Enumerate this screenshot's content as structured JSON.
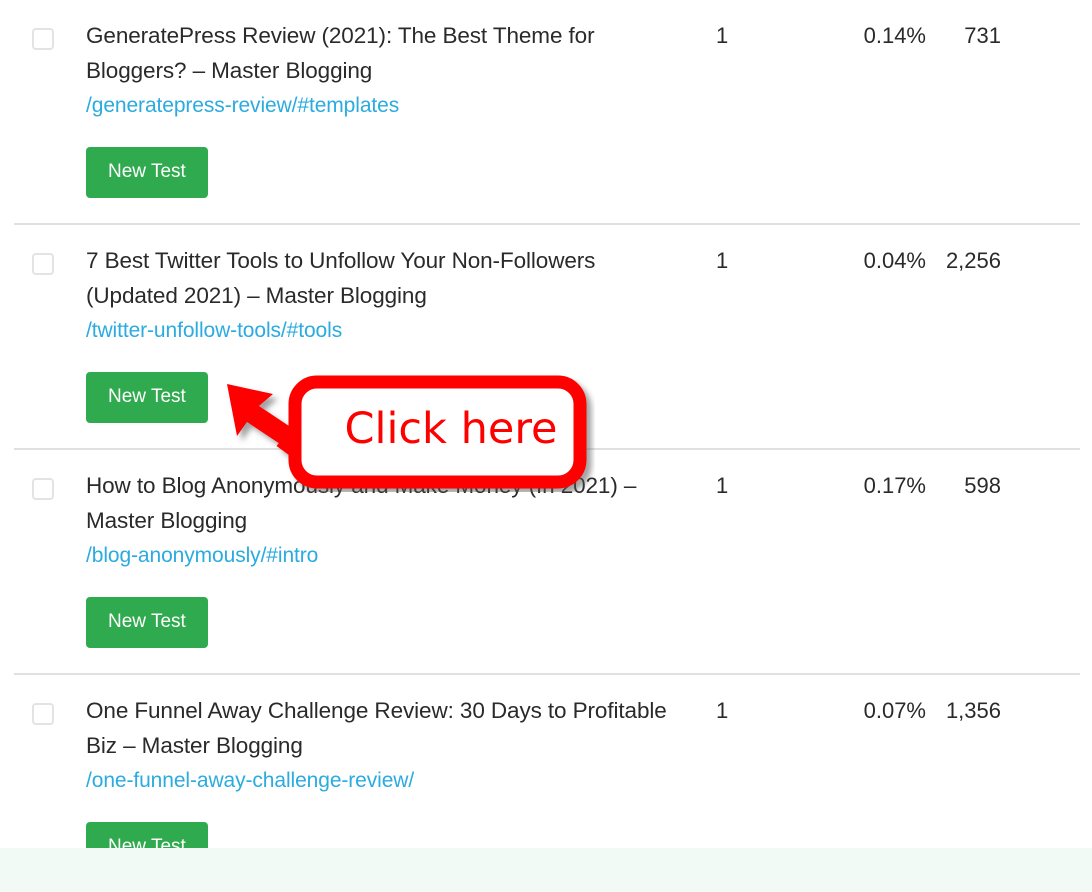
{
  "table": {
    "rows": [
      {
        "checkbox_checked": false,
        "title": "GeneratePress Review (2021): The Best Theme for Bloggers? – Master Blogging",
        "url": "/generatepress-review/#templates",
        "button_label": "New Test",
        "clicks": "1",
        "ctr": "0.14%",
        "impressions": "731"
      },
      {
        "checkbox_checked": false,
        "title": "7 Best Twitter Tools to Unfollow Your Non-Followers (Updated 2021) – Master Blogging",
        "url": "/twitter-unfollow-tools/#tools",
        "button_label": "New Test",
        "clicks": "1",
        "ctr": "0.04%",
        "impressions": "2,256"
      },
      {
        "checkbox_checked": false,
        "title": "How to Blog Anonymously and Make Money (In 2021) – Master Blogging",
        "url": "/blog-anonymously/#intro",
        "button_label": "New Test",
        "clicks": "1",
        "ctr": "0.17%",
        "impressions": "598"
      },
      {
        "checkbox_checked": false,
        "title": "One Funnel Away Challenge Review: 30 Days to Profitable Biz – Master Blogging",
        "url": "/one-funnel-away-challenge-review/",
        "button_label": "New Test",
        "clicks": "1",
        "ctr": "0.07%",
        "impressions": "1,356"
      }
    ]
  },
  "annotation": {
    "label": "Click here",
    "box_color": "#ff0000",
    "box_fill": "#ffffff",
    "arrow_color": "#ff0000",
    "points_to": "New Test"
  },
  "colors": {
    "button_green": "#2faa4e",
    "link_blue": "#2babe0",
    "text_dark": "#2a2a2a",
    "divider": "#e0e0e0",
    "checkbox_border": "#e3e3e3",
    "bottom_overlay": "#f2faf5"
  }
}
